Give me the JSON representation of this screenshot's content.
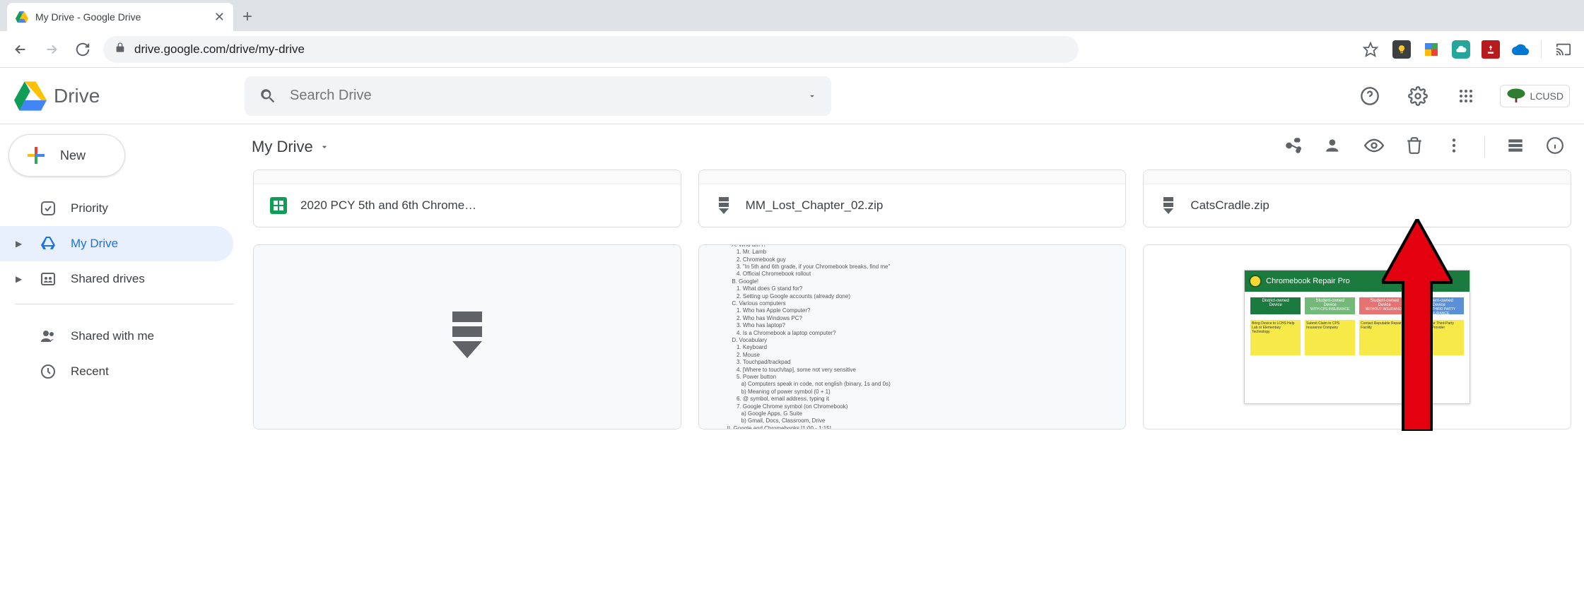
{
  "browser": {
    "tab_title": "My Drive - Google Drive",
    "url": "drive.google.com/drive/my-drive",
    "extensions": [
      "keep",
      "docs",
      "cloud",
      "pdf",
      "onedrive"
    ],
    "cast": true
  },
  "header": {
    "product_name": "Drive",
    "search_placeholder": "Search Drive",
    "org_label": "LCUSD"
  },
  "sidebar": {
    "new_label": "New",
    "items": [
      {
        "label": "Priority",
        "icon": "priority"
      },
      {
        "label": "My Drive",
        "icon": "mydrive",
        "active": true,
        "expandable": true
      },
      {
        "label": "Shared drives",
        "icon": "shared-drives",
        "expandable": true
      }
    ],
    "lower_items": [
      {
        "label": "Shared with me",
        "icon": "shared-with-me"
      },
      {
        "label": "Recent",
        "icon": "recent"
      }
    ]
  },
  "content": {
    "breadcrumb": "My Drive",
    "action_icons": [
      "share",
      "preview",
      "trash",
      "more",
      "|",
      "list-view",
      "details"
    ],
    "files_row1": [
      {
        "name": "2020 PCY 5th and 6th Chrome…",
        "type": "sheets"
      },
      {
        "name": "MM_Lost_Chapter_02.zip",
        "type": "zip"
      },
      {
        "name": "CatsCradle.zip",
        "type": "zip"
      }
    ],
    "files_row2": [
      {
        "name": "",
        "type": "zip-preview"
      },
      {
        "name": "",
        "type": "doc-preview"
      },
      {
        "name": "",
        "type": "slides-preview",
        "slide_title": "Chromebook Repair Pro"
      }
    ]
  },
  "annotation": {
    "arrow_points_to": "more-actions-icon"
  }
}
